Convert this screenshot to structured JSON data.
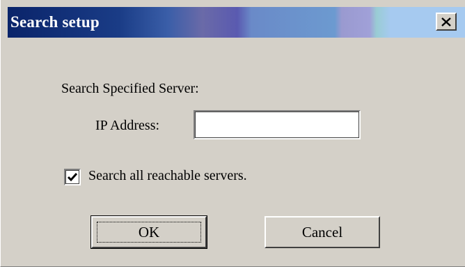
{
  "window": {
    "title": "Search setup",
    "close_glyph": "✕",
    "close_icon": "close-icon"
  },
  "form": {
    "section_label": "Search Specified Server:",
    "ip_label": "IP Address:",
    "ip_value": "",
    "ip_placeholder": "",
    "checkbox_label": "Search all reachable servers.",
    "checkbox_checked": true
  },
  "buttons": {
    "ok_label": "OK",
    "cancel_label": "Cancel"
  },
  "colors": {
    "title_gradient_start": "#0a246a",
    "title_gradient_end": "#a6caf0",
    "face": "#d4d0c8"
  }
}
